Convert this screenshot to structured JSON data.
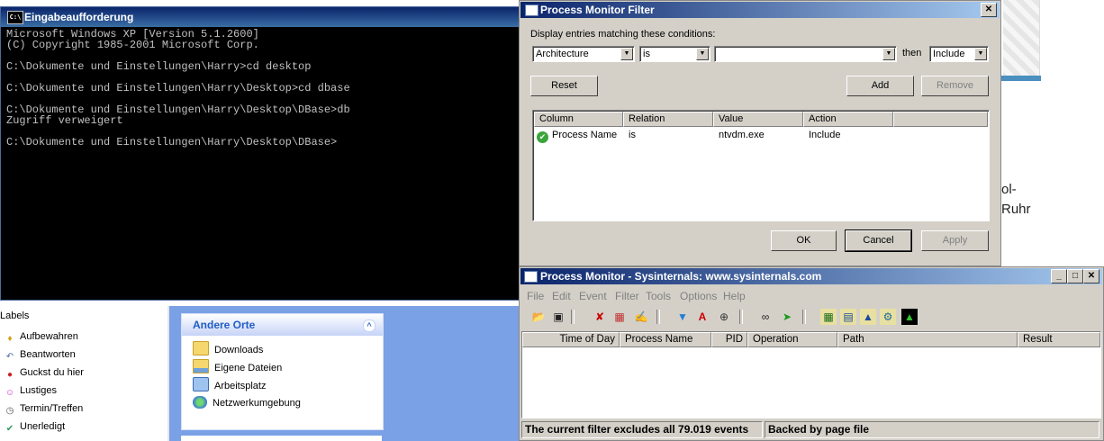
{
  "cmd": {
    "title": "Eingabeaufforderung",
    "icon_text": "C:\\",
    "lines": [
      "Microsoft Windows XP [Version 5.1.2600]",
      "(C) Copyright 1985-2001 Microsoft Corp.",
      "",
      "C:\\Dokumente und Einstellungen\\Harry>cd desktop",
      "",
      "C:\\Dokumente und Einstellungen\\Harry\\Desktop>cd dbase",
      "",
      "C:\\Dokumente und Einstellungen\\Harry\\Desktop\\DBase>db",
      "Zugriff verweigert",
      "",
      "C:\\Dokumente und Einstellungen\\Harry\\Desktop\\DBase>"
    ]
  },
  "background_page": {
    "text1": "ol-",
    "text2": "Ruhr"
  },
  "labels": {
    "header": "Labels",
    "items": [
      {
        "label": "Aufbewahren",
        "icon": "trophy-icon",
        "color": "#d4a017",
        "glyph": "♦"
      },
      {
        "label": "Beantworten",
        "icon": "reply-arrow-icon",
        "color": "#4a6fa5",
        "glyph": "↶"
      },
      {
        "label": "Guckst du hier",
        "icon": "red-dot-icon",
        "color": "#cc2222",
        "glyph": "●"
      },
      {
        "label": "Lustiges",
        "icon": "smiley-icon",
        "color": "#cc33cc",
        "glyph": "☺"
      },
      {
        "label": "Termin/Treffen",
        "icon": "clock-icon",
        "color": "#555555",
        "glyph": "◷"
      },
      {
        "label": "Unerledigt",
        "icon": "checkmark-icon",
        "color": "#2a9a5a",
        "glyph": "✔"
      }
    ]
  },
  "places": {
    "title": "Andere Orte",
    "chevron": "»",
    "items": [
      {
        "label": "Downloads",
        "icon": "folder-icon"
      },
      {
        "label": "Eigene Dateien",
        "icon": "documents-folder-icon"
      },
      {
        "label": "Arbeitsplatz",
        "icon": "computer-icon"
      },
      {
        "label": "Netzwerkumgebung",
        "icon": "network-icon"
      }
    ]
  },
  "filter_dialog": {
    "title": "Process Monitor Filter",
    "close_label": "✕",
    "prompt": "Display entries matching these conditions:",
    "column_value": "Architecture",
    "relation_value": "is",
    "value_value": "",
    "then_label": "then",
    "action_value": "Include",
    "reset_label": "Reset",
    "add_label": "Add",
    "remove_label": "Remove",
    "columns": [
      "Column",
      "Relation",
      "Value",
      "Action"
    ],
    "rows": [
      {
        "column": "Process Name",
        "relation": "is",
        "value": "ntvdm.exe",
        "action": "Include",
        "enabled": true
      }
    ],
    "ok_label": "OK",
    "cancel_label": "Cancel",
    "apply_label": "Apply"
  },
  "procmon": {
    "title": "Process Monitor - Sysinternals: www.sysinternals.com",
    "menu": [
      "File",
      "Edit",
      "Event",
      "Filter",
      "Tools",
      "Options",
      "Help"
    ],
    "window_buttons": [
      "_",
      "□",
      "✕"
    ],
    "columns": [
      "Time of Day",
      "Process Name",
      "PID",
      "Operation",
      "Path",
      "Result"
    ],
    "status_left": "The current filter excludes all 79.019 events",
    "status_right": "Backed by page file"
  }
}
